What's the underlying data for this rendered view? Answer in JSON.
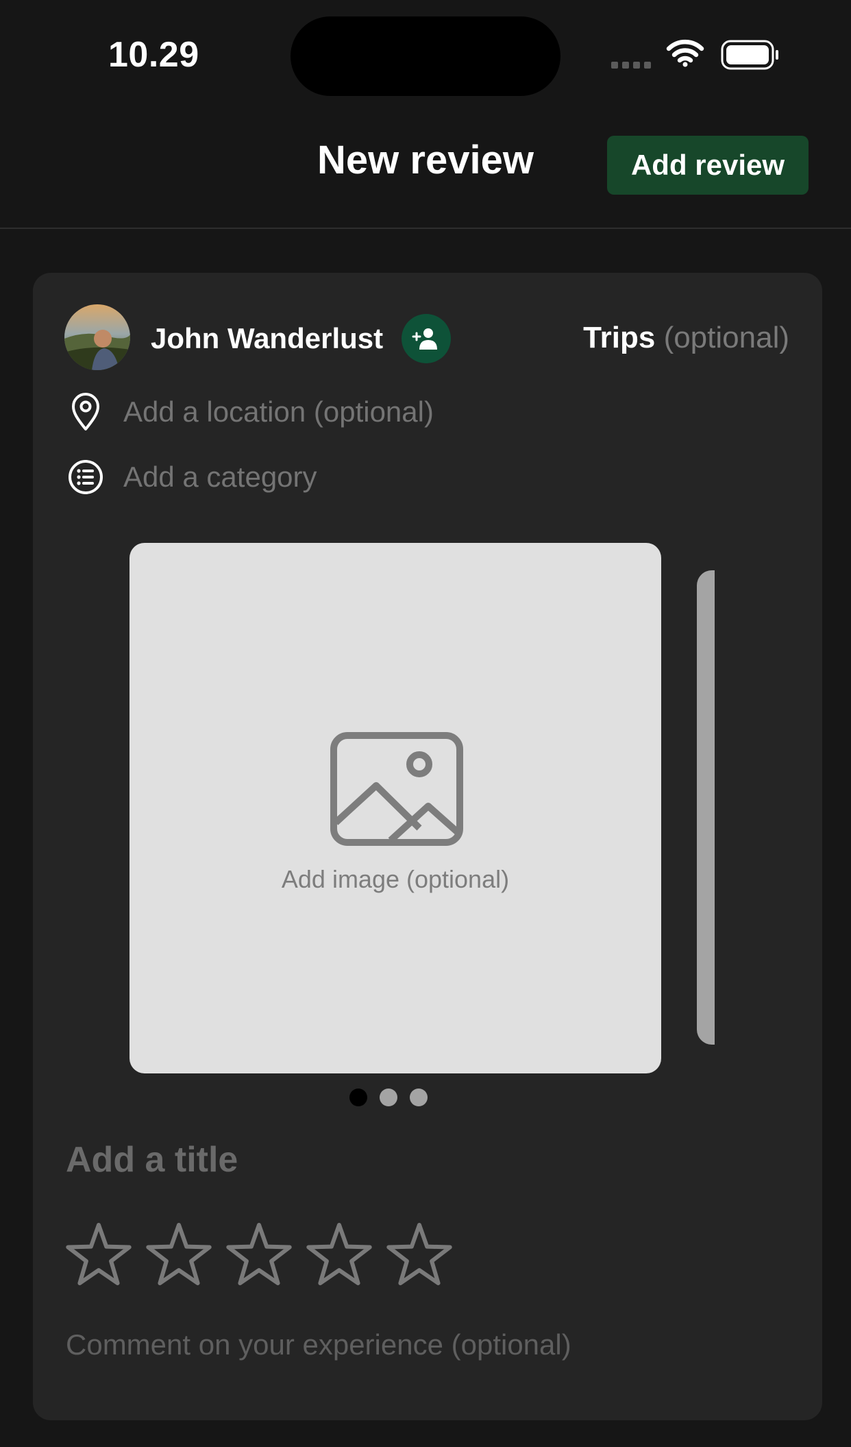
{
  "status_bar": {
    "time": "10.29",
    "icons": [
      "signal-dots-icon",
      "wifi-icon",
      "battery-icon"
    ]
  },
  "nav": {
    "title": "New review",
    "action_label": "Add review",
    "action_color": "#17472a"
  },
  "card": {
    "user": {
      "name": "John Wanderlust",
      "avatar": "avatar",
      "add_icon": "add-person-icon",
      "add_icon_color": "#0e5238"
    },
    "trips": {
      "label": "Trips",
      "hint": "(optional)"
    },
    "location": {
      "placeholder": "Add a location (optional)",
      "icon": "location-pin-icon"
    },
    "category": {
      "placeholder": "Add a category",
      "icon": "list-icon"
    },
    "image": {
      "label": "Add image (optional)",
      "icon": "image-icon"
    },
    "carousel": {
      "count": 3,
      "active_index": 0
    },
    "title_placeholder": "Add a title",
    "rating": {
      "max": 5,
      "value": 0
    },
    "comment_placeholder": "Comment on your experience (optional)"
  }
}
